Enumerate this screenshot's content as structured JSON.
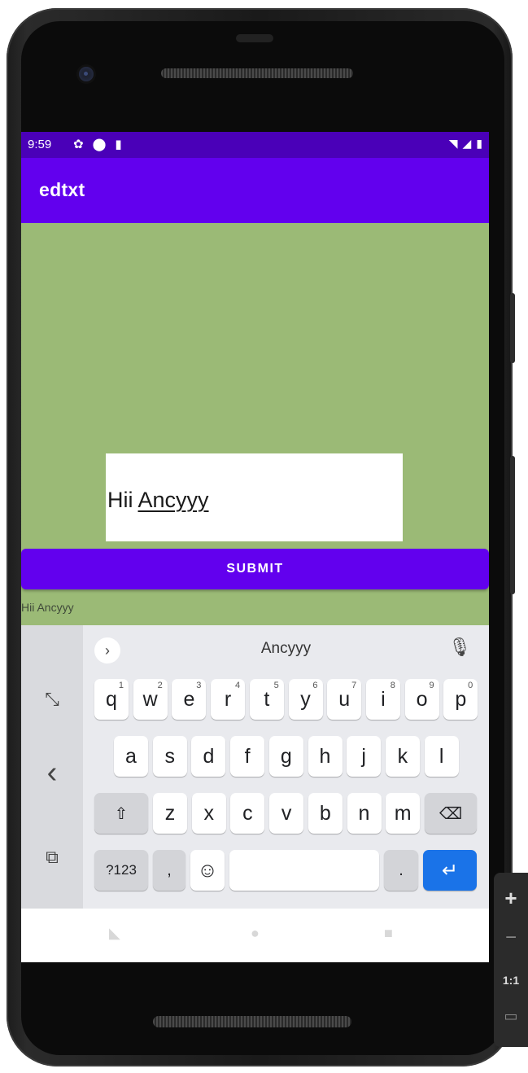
{
  "status_bar": {
    "time": "9:59",
    "left_icons": [
      "settings-icon",
      "play-protect-icon",
      "sd-card-icon"
    ],
    "right_icons": [
      "wifi-icon",
      "signal-icon",
      "battery-icon"
    ]
  },
  "app_bar": {
    "title": "edtxt"
  },
  "edit_text": {
    "text_part1": "Hii ",
    "text_part2": "Ancyyy"
  },
  "submit_button": {
    "label": "SUBMIT"
  },
  "output_text": "Hii Ancyyy",
  "keyboard": {
    "suggestion": "Ancyyy",
    "row1": [
      {
        "key": "q",
        "hint": "1"
      },
      {
        "key": "w",
        "hint": "2"
      },
      {
        "key": "e",
        "hint": "3"
      },
      {
        "key": "r",
        "hint": "4"
      },
      {
        "key": "t",
        "hint": "5"
      },
      {
        "key": "y",
        "hint": "6"
      },
      {
        "key": "u",
        "hint": "7"
      },
      {
        "key": "i",
        "hint": "8"
      },
      {
        "key": "o",
        "hint": "9"
      },
      {
        "key": "p",
        "hint": "0"
      }
    ],
    "row2": [
      "a",
      "s",
      "d",
      "f",
      "g",
      "h",
      "j",
      "k",
      "l"
    ],
    "row3": [
      "z",
      "x",
      "c",
      "v",
      "b",
      "n",
      "m"
    ],
    "symbols_label": "?123",
    "comma": ",",
    "period": ".",
    "shift_icon": "⇧",
    "backspace_icon": "⌫",
    "emoji_icon": "☺",
    "enter_icon": "↵",
    "mic_icon": "🎙",
    "chevron_icon": "›",
    "side_icons": {
      "resize": "⤡",
      "back": "‹",
      "floating": "⧉"
    }
  },
  "emulator_panel": {
    "zoom_in": "+",
    "zoom_out": "−",
    "ratio": "1:1"
  }
}
